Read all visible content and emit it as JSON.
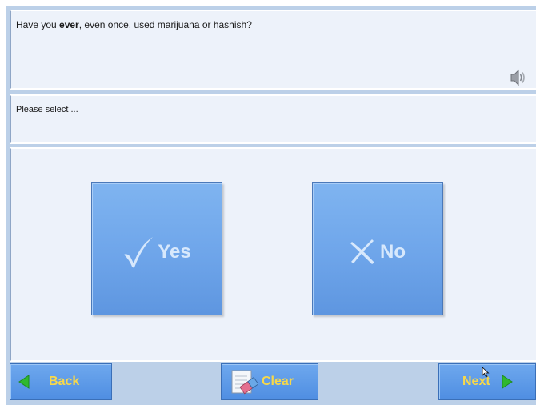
{
  "question": {
    "text_before": "Have you ",
    "emphasis": "ever",
    "text_after": ", even once, used marijuana or hashish?"
  },
  "instruction": "Please select ...",
  "choices": {
    "yes": "Yes",
    "no": "No"
  },
  "nav": {
    "back": "Back",
    "clear": "Clear",
    "next": "Next"
  },
  "colors": {
    "panel": "#edf2fa",
    "frame": "#bcd0e8",
    "button": "#6ea5ea",
    "nav_label": "#f7d84a",
    "arrow": "#2fb82f"
  },
  "icons": {
    "speaker": "speaker-icon",
    "check": "check-icon",
    "x": "x-icon",
    "back": "left-arrow-icon",
    "next": "right-arrow-icon",
    "clear": "eraser-icon"
  }
}
